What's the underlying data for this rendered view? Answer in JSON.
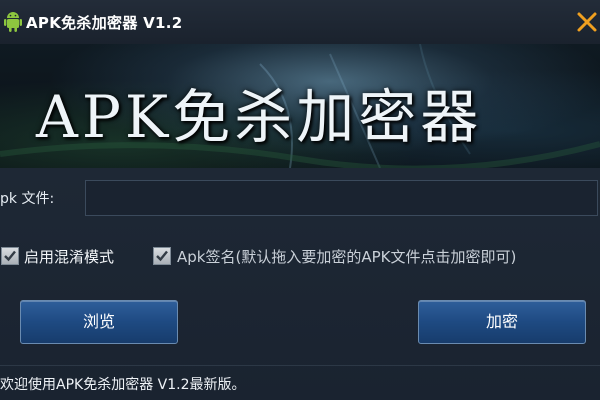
{
  "window": {
    "title": "APK免杀加密器 V1.2",
    "close_icon": "close-x-icon",
    "app_icon": "android-icon",
    "accent": "#f0a020"
  },
  "banner": {
    "text": "APK免杀加密器"
  },
  "form": {
    "file_label": "pk 文件:",
    "file_value": "",
    "file_placeholder": ""
  },
  "options": [
    {
      "label": "启用混淆模式",
      "checked": true
    },
    {
      "label": "Apk签名(默认拖入要加密的APK文件点击加密即可)",
      "checked": true
    }
  ],
  "buttons": {
    "browse": "浏览",
    "encrypt": "加密"
  },
  "status": {
    "text": "欢迎使用APK免杀加密器 V1.2最新版。"
  }
}
